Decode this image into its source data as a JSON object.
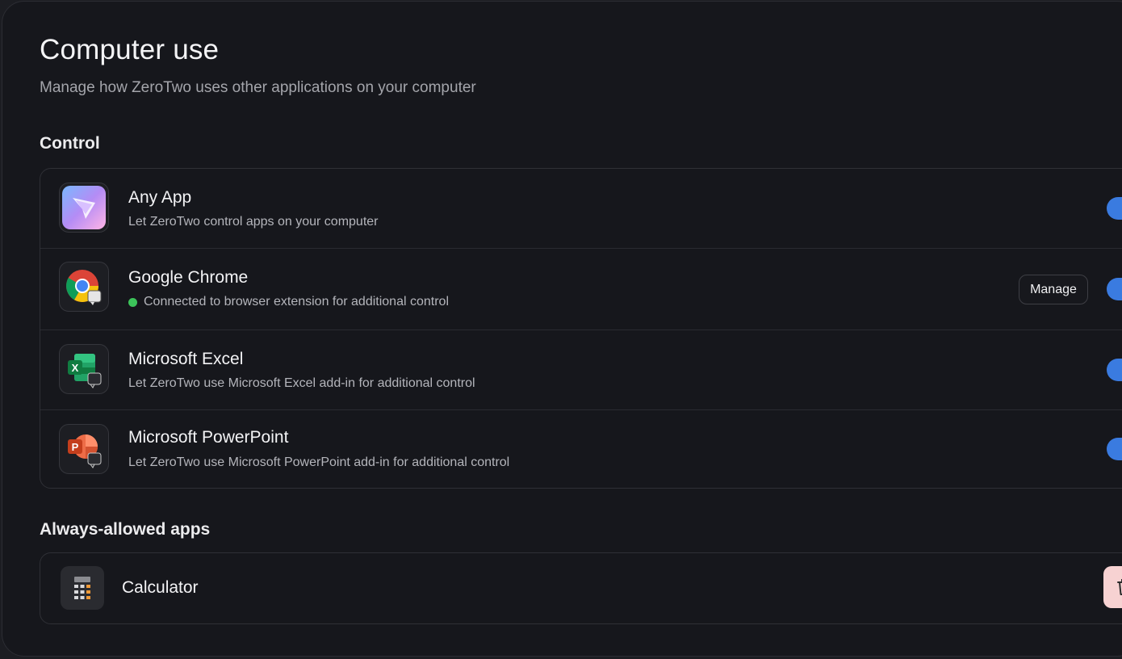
{
  "page": {
    "title": "Computer use",
    "subtitle": "Manage how ZeroTwo uses other applications on your computer"
  },
  "control": {
    "heading": "Control",
    "items": [
      {
        "name": "Any App",
        "description": "Let ZeroTwo control apps on your computer",
        "icon": "app-logo-icon",
        "enabled": true
      },
      {
        "name": "Google Chrome",
        "description": "Connected to browser extension for additional control",
        "status": "connected",
        "status_color": "#3cc45a",
        "manage_label": "Manage",
        "icon": "chrome-icon",
        "enabled": true
      },
      {
        "name": "Microsoft Excel",
        "description": "Let ZeroTwo use Microsoft Excel add-in for additional control",
        "icon": "excel-icon",
        "enabled": true
      },
      {
        "name": "Microsoft PowerPoint",
        "description": "Let ZeroTwo use Microsoft PowerPoint add-in for additional control",
        "icon": "powerpoint-icon",
        "enabled": true
      }
    ]
  },
  "always_allowed": {
    "heading": "Always-allowed apps",
    "items": [
      {
        "name": "Calculator",
        "icon": "calculator-icon",
        "action_icon": "trash-icon"
      }
    ]
  },
  "colors": {
    "accent": "#3a7be0",
    "background": "#16171c",
    "danger_bg": "#f7d2d2"
  }
}
